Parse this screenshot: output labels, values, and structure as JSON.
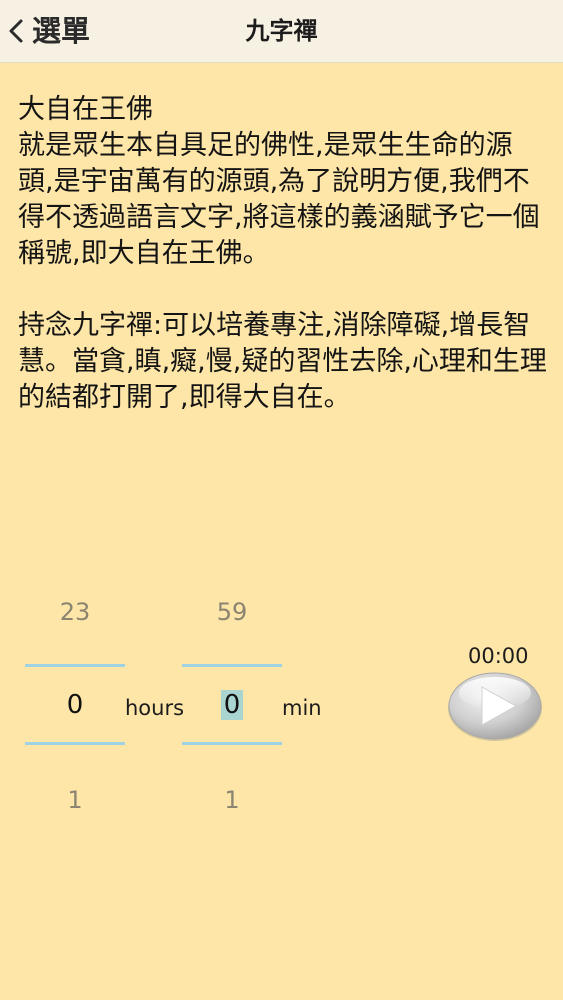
{
  "header": {
    "back_label": "選單",
    "title": "九字禪"
  },
  "content": {
    "heading": "大自在王佛",
    "paragraph1": "就是眾生本自具足的佛性,是眾生生命的源頭,是宇宙萬有的源頭,為了說明方便,我們不得不透過語言文字,將這樣的義涵賦予它一個稱號,即大自在王佛。",
    "paragraph2": "持念九字禪:可以培養專注,消除障礙,增長智慧。當貪,瞋,癡,慢,疑的習性去除,心理和生理的結都打開了,即得大自在。"
  },
  "timer": {
    "hours": {
      "prev": "23",
      "current": "0",
      "next": "1",
      "unit": "hours"
    },
    "minutes": {
      "prev": "59",
      "current": "0",
      "next": "1",
      "unit": "min"
    },
    "elapsed": "00:00",
    "play_icon": "play-icon"
  },
  "colors": {
    "background": "#fde6a7",
    "top_bar": "#f7f1e3",
    "picker_line": "#9fd2e3",
    "cursor_highlight": "#a9d4cf"
  }
}
